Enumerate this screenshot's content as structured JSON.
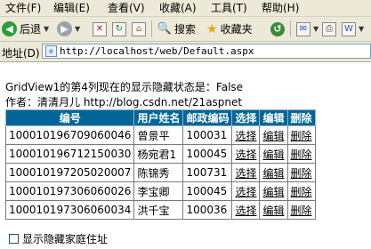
{
  "menu": [
    "文件(F)",
    "编辑(E)",
    "查看(V)",
    "收藏(A)",
    "工具(T)",
    "帮助(H)"
  ],
  "toolbar": {
    "back_label": "后退",
    "search_label": "搜索",
    "favorites_label": "收藏夹"
  },
  "address": {
    "label": "地址(D)",
    "url": "http://localhost/web/Default.aspx"
  },
  "status_line": "GridView1的第4列现在的显示隐藏状态是：False",
  "author_line": "作者：清清月儿 http://blog.csdn.net/21aspnet",
  "grid": {
    "headers": [
      "编号",
      "用户姓名",
      "邮政编码",
      "选择",
      "编辑",
      "删除"
    ],
    "rows": [
      [
        "100010196709060046",
        "曾景平",
        "100031",
        "选择",
        "编辑",
        "删除"
      ],
      [
        "100010196712150030",
        "杨宛君1",
        "100045",
        "选择",
        "编辑",
        "删除"
      ],
      [
        "100010197205020007",
        "陈锦秀",
        "100731",
        "选择",
        "编辑",
        "删除"
      ],
      [
        "100010197306060026",
        "李宝卿",
        "100045",
        "选择",
        "编辑",
        "删除"
      ],
      [
        "100010197306060034",
        "洪千宝",
        "100036",
        "选择",
        "编辑",
        "删除"
      ]
    ]
  },
  "checkbox_label": "显示隐藏家庭住址",
  "colors": {
    "header_bg": "#006699",
    "chrome_bg": "#ece9d8"
  }
}
